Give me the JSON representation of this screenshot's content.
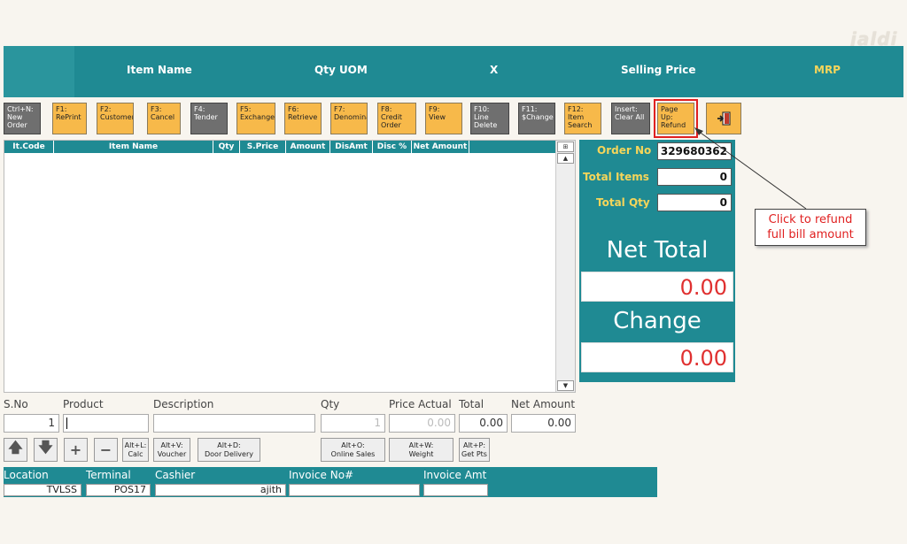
{
  "watermark": "jaldi",
  "header": {
    "columns": [
      "Item Name",
      "Qty UOM",
      "X",
      "Selling Price",
      "MRP"
    ],
    "colors": {
      "bar": "#1f8a93",
      "mrp": "#f5d55a"
    }
  },
  "toolbar": [
    {
      "label": "Ctrl+N:\nNew\nOrder",
      "style": "gray"
    },
    {
      "label": "F1:\nRePrint",
      "style": "orange"
    },
    {
      "label": "F2:\nCustomer",
      "style": "orange"
    },
    {
      "label": "F3:\nCancel",
      "style": "orange"
    },
    {
      "label": "F4:\nTender",
      "style": "gray"
    },
    {
      "label": "F5:\nExchange",
      "style": "orange"
    },
    {
      "label": "F6:\nRetrieve",
      "style": "orange"
    },
    {
      "label": "F7:\nDenomina",
      "style": "orange"
    },
    {
      "label": "F8:\nCredit\nOrder",
      "style": "orange"
    },
    {
      "label": "F9:\nView",
      "style": "orange"
    },
    {
      "label": "F10:\nLine\nDelete",
      "style": "gray"
    },
    {
      "label": "F11:\n$Change",
      "style": "gray"
    },
    {
      "label": "F12:\nItem\nSearch",
      "style": "orange"
    },
    {
      "label": "Insert:\nClear All",
      "style": "gray"
    },
    {
      "label": "Page Up:\nRefund",
      "style": "orange",
      "highlight": true
    }
  ],
  "exit_icon": "exit-icon",
  "grid": {
    "columns": [
      "It.Code",
      "Item Name",
      "Qty",
      "S.Price",
      "Amount",
      "DisAmt",
      "Disc %",
      "Net Amount"
    ]
  },
  "panel": {
    "order_no_label": "Order No",
    "order_no": "329680362",
    "total_items_label": "Total Items",
    "total_items": "0",
    "total_qty_label": "Total Qty",
    "total_qty": "0",
    "net_total_label": "Net Total",
    "net_total": "0.00",
    "change_label": "Change",
    "change": "0.00"
  },
  "callout": {
    "line1": "Click to refund",
    "line2": "full bill amount"
  },
  "entry": {
    "labels": {
      "sno": "S.No",
      "product": "Product",
      "description": "Description",
      "qty": "Qty",
      "price_actual": "Price Actual",
      "total": "Total",
      "net_amount": "Net Amount"
    },
    "sno": "1",
    "product": "",
    "description": "",
    "qty": "1",
    "price_actual": "0.00",
    "total": "0.00",
    "net_amount": "0.00"
  },
  "buttons": {
    "calc": "Alt+L:\nCalc",
    "voucher": "Alt+V:\nVoucher",
    "door_delivery": "Alt+D:\nDoor Delivery",
    "online_sales": "Alt+O:\nOnline Sales",
    "weight": "Alt+W:\nWeight",
    "get_pts": "Alt+P:\nGet Pts"
  },
  "footer": {
    "labels": {
      "location": "Location",
      "terminal": "Terminal",
      "cashier": "Cashier",
      "invoice_no": "Invoice No#",
      "invoice_amt": "Invoice Amt"
    },
    "location": "TVLSS",
    "terminal": "POS17",
    "cashier": "ajith",
    "invoice_no": "",
    "invoice_amt": ""
  }
}
